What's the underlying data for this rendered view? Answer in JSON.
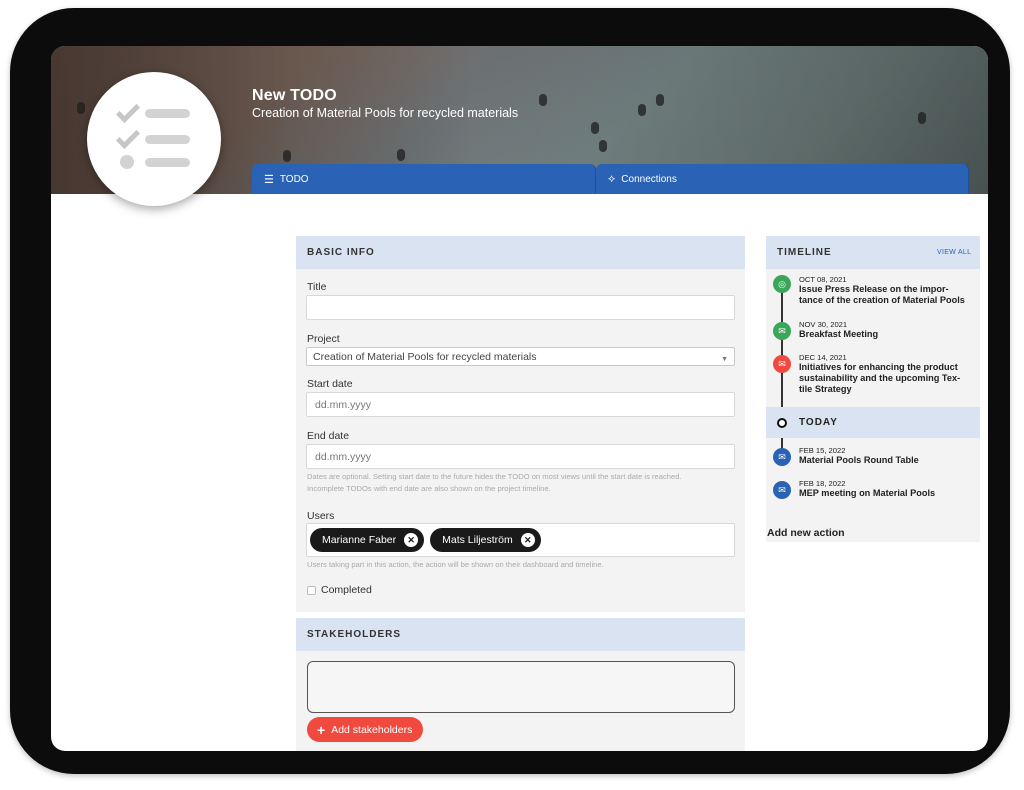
{
  "header": {
    "title": "New TODO",
    "subtitle": "Creation of Material Pools for recycled materials"
  },
  "tabs": [
    {
      "label": "TODO",
      "icon": "list-check-icon"
    },
    {
      "label": "Connections",
      "icon": "connections-icon"
    }
  ],
  "basic_info": {
    "heading": "BASIC INFO",
    "title_label": "Title",
    "title_value": "",
    "project_label": "Project",
    "project_value": "Creation of Material Pools for recycled materials",
    "start_label": "Start date",
    "start_placeholder": "dd.mm.yyyy",
    "end_label": "End date",
    "end_placeholder": "dd.mm.yyyy",
    "dates_help_1": "Dates are optional. Setting start date to the future hides the TODO on most views until the start date is reached.",
    "dates_help_2": "Incomplete TODOs with end date are also shown on the project timeline.",
    "users_label": "Users",
    "users": [
      "Marianne Faber",
      "Mats Liljeström"
    ],
    "users_help": "Users taking part in this action, the action will be shown on their dashboard and timeline.",
    "completed_label": "Completed"
  },
  "stakeholders": {
    "heading": "STAKEHOLDERS",
    "add_label": "Add stakeholders"
  },
  "timeline": {
    "heading": "TIMELINE",
    "view_all": "VIEW ALL",
    "today_label": "TODAY",
    "add_action": "Add new action",
    "past": [
      {
        "date": "OCT 08, 2021",
        "line1": "Issue Press Release on the impor-",
        "line2": "tance of the creation of Material Pools",
        "line3": "",
        "color": "#3aa65a",
        "icon": "target-icon"
      },
      {
        "date": "NOV 30, 2021",
        "line1": "Breakfast Meeting",
        "line2": "",
        "line3": "",
        "color": "#3aa65a",
        "icon": "chat-icon"
      },
      {
        "date": "DEC 14, 2021",
        "line1": "Initiatives for enhancing the product",
        "line2": "sustainability and the upcoming Tex-",
        "line3": "tile Strategy",
        "color": "#ef4a3f",
        "icon": "chat-icon"
      }
    ],
    "future": [
      {
        "date": "FEB 15, 2022",
        "line1": "Material Pools Round Table",
        "color": "#2a62b5",
        "icon": "chat-icon"
      },
      {
        "date": "FEB 18, 2022",
        "line1": "MEP meeting on Material Pools",
        "color": "#2a62b5",
        "icon": "chat-icon"
      }
    ]
  }
}
